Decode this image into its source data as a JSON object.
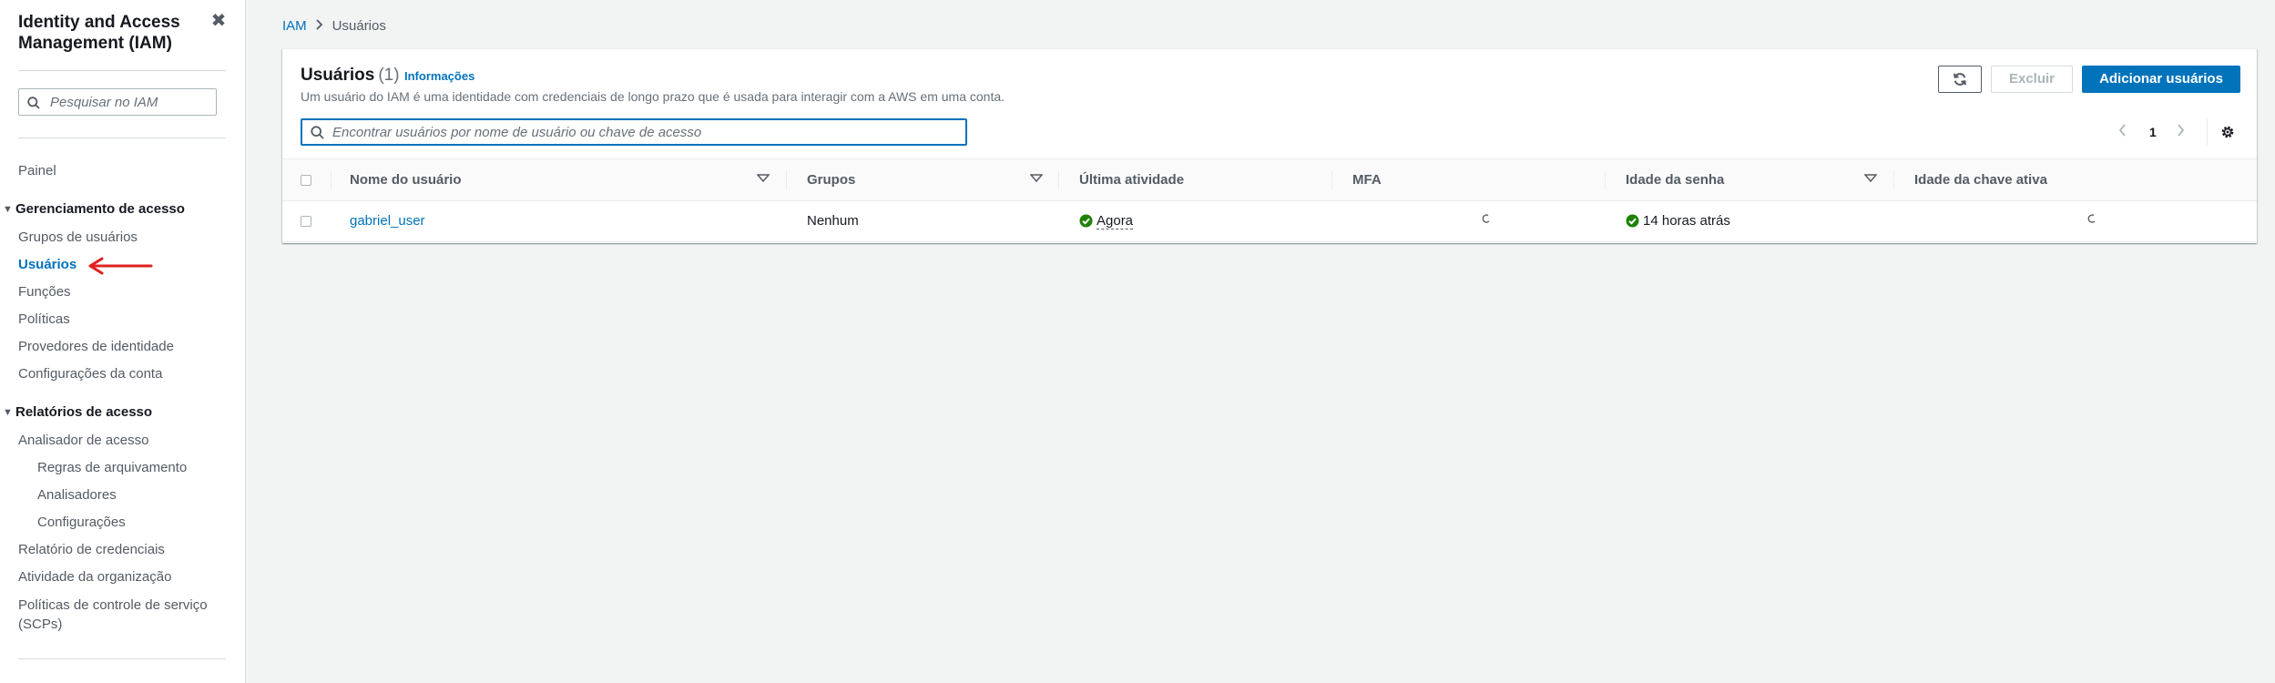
{
  "sidebar": {
    "title": "Identity and Access Management (IAM)",
    "search_placeholder": "Pesquisar no IAM",
    "dashboard": "Painel",
    "sections": [
      {
        "label": "Gerenciamento de acesso",
        "items": [
          "Grupos de usuários",
          "Usuários",
          "Funções",
          "Políticas",
          "Provedores de identidade",
          "Configurações da conta"
        ]
      },
      {
        "label": "Relatórios de acesso",
        "items": [
          "Analisador de acesso",
          "Regras de arquivamento",
          "Analisadores",
          "Configurações",
          "Relatório de credenciais",
          "Atividade da organização",
          "Políticas de controle de serviço (SCPs)"
        ]
      }
    ],
    "active_item": "Usuários",
    "annotation_arrow_color": "#e02020"
  },
  "breadcrumb": {
    "root": "IAM",
    "current": "Usuários"
  },
  "users_panel": {
    "title": "Usuários",
    "count": "(1)",
    "info_link": "Informações",
    "description": "Um usuário do IAM é uma identidade com credenciais de longo prazo que é usada para interagir com a AWS em uma conta.",
    "buttons": {
      "refresh_icon": "refresh-icon",
      "delete": "Excluir",
      "add": "Adicionar usuários"
    },
    "filter_placeholder": "Encontrar usuários por nome de usuário ou chave de acesso",
    "pagination": {
      "page": "1"
    },
    "columns": [
      "Nome do usuário",
      "Grupos",
      "Última atividade",
      "MFA",
      "Idade da senha",
      "Idade da chave ativa"
    ],
    "rows": [
      {
        "user_name": "gabriel_user",
        "groups": "Nenhum",
        "last_activity": "Agora",
        "mfa": "",
        "password_age": "14 horas atrás",
        "active_key_age": ""
      }
    ]
  },
  "colors": {
    "accent": "#0073bb",
    "success": "#1d8102",
    "primary_button": "#0073bb"
  }
}
